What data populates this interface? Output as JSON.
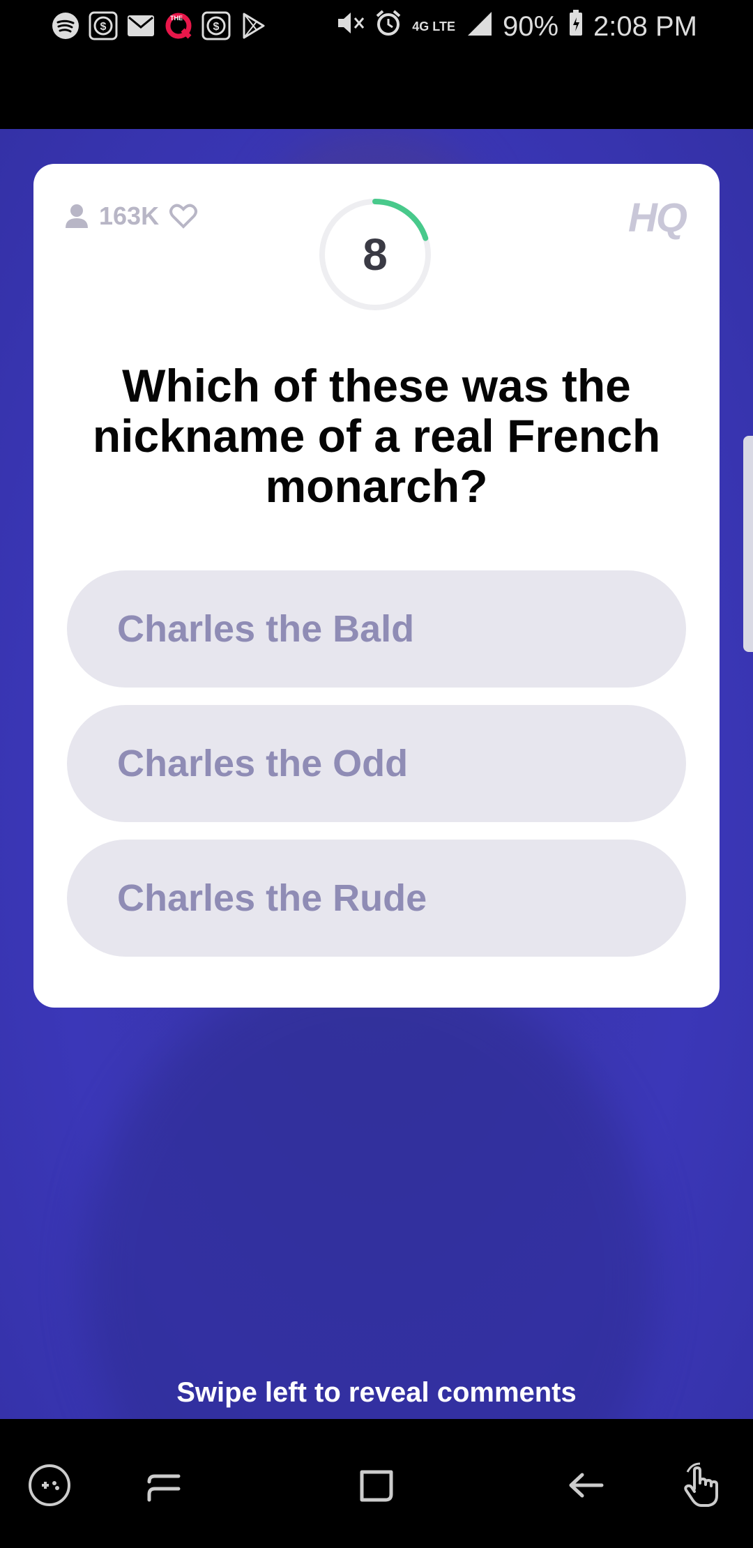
{
  "status_bar": {
    "icons_left": [
      "spotify-icon",
      "app-icon",
      "mail-icon",
      "theq-icon",
      "app-icon",
      "play-store-icon"
    ],
    "icons_right": [
      "mute-icon",
      "alarm-icon",
      "lte-icon",
      "signal-icon"
    ],
    "network": "4G LTE",
    "battery": "90%",
    "time": "2:08 PM"
  },
  "game": {
    "viewers": "163K",
    "timer": "8",
    "logo": "HQ",
    "question": "Which of these was the nickname of a real French monarch?",
    "answers": [
      "Charles the Bald",
      "Charles the Odd",
      "Charles the Rude"
    ],
    "swipe_hint": "Swipe left to reveal comments",
    "timer_progress": 0.2
  },
  "nav_bar": {
    "items": [
      "game-tools-icon",
      "recents-icon",
      "home-icon",
      "back-icon",
      "touch-icon"
    ]
  },
  "colors": {
    "timer_arc": "#48c98b",
    "answer_bg": "#e7e6ee",
    "answer_text": "#8f8cb5",
    "stage_bg": "#3a36b0"
  }
}
